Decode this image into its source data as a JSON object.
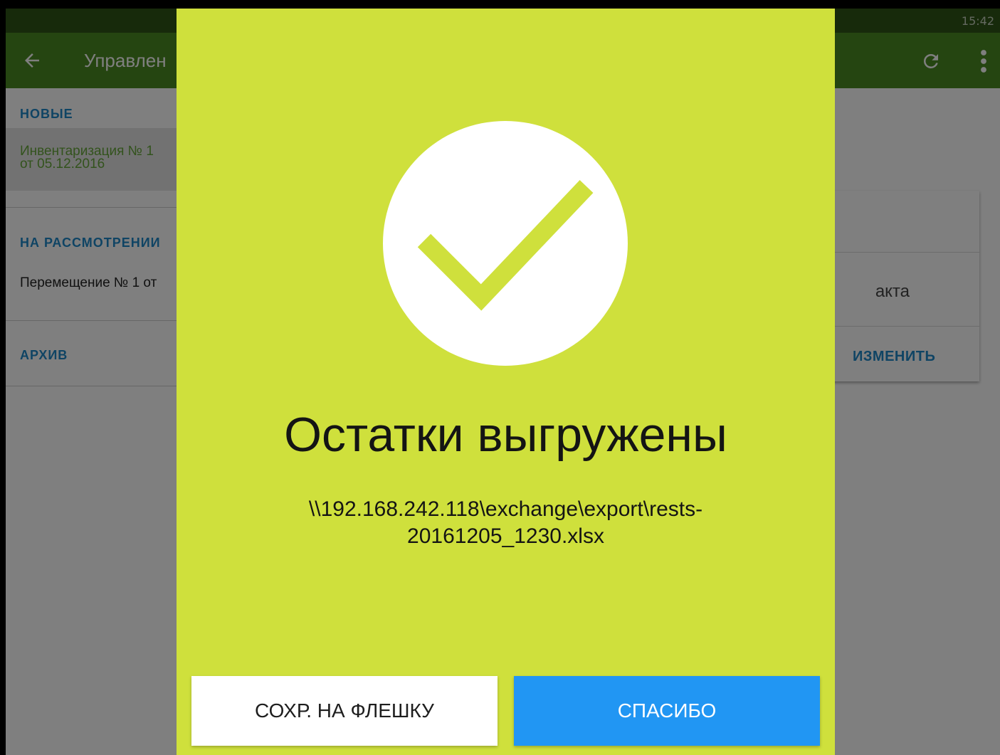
{
  "status_bar": {
    "time": "15:42"
  },
  "app_bar": {
    "title": "Управлен",
    "back_icon": "arrow-left-icon",
    "refresh_icon": "refresh-icon",
    "more_icon": "more-vertical-icon"
  },
  "list": {
    "sections": [
      {
        "header": "НОВЫЕ"
      },
      {
        "header": "НА РАССМОТРЕНИИ"
      },
      {
        "header": "АРХИВ"
      }
    ],
    "new_item": "Инвентаризация № 1\nот 05.12.2016",
    "review_item": "Перемещение № 1 от"
  },
  "card": {
    "text": "акта",
    "action": "ИЗМЕНИТЬ"
  },
  "dialog": {
    "icon": "checkmark-circle-icon",
    "title": "Остатки выгружены",
    "path": "\\\\192.168.242.118\\exchange\\export\\rests-20161205_1230.xlsx",
    "save_button": "СОХР. НА ФЛЕШКУ",
    "ok_button": "СПАСИБО"
  },
  "colors": {
    "dialog_bg": "#cfe03c",
    "app_bar": "#4b8a22",
    "status_bar": "#2e5416",
    "accent_blue": "#2196f3",
    "section_header": "#1f88c9"
  }
}
